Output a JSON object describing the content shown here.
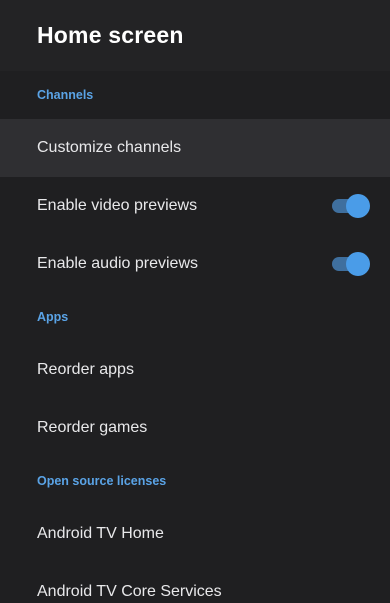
{
  "header": {
    "title": "Home screen"
  },
  "sections": {
    "channels": "Channels",
    "apps": "Apps",
    "licenses": "Open source licenses"
  },
  "channels": {
    "customize": "Customize channels",
    "video_previews": {
      "label": "Enable video previews",
      "enabled": true
    },
    "audio_previews": {
      "label": "Enable audio previews",
      "enabled": true
    }
  },
  "apps": {
    "reorder_apps": "Reorder apps",
    "reorder_games": "Reorder games"
  },
  "licenses": {
    "atv_home": "Android TV Home",
    "atv_core": "Android TV Core Services"
  },
  "colors": {
    "accent": "#5aa3e6",
    "toggle_thumb": "#4a9ce8",
    "toggle_track": "#3f6f9e",
    "background": "#1f1f21",
    "focused_row": "#2f2f32"
  }
}
